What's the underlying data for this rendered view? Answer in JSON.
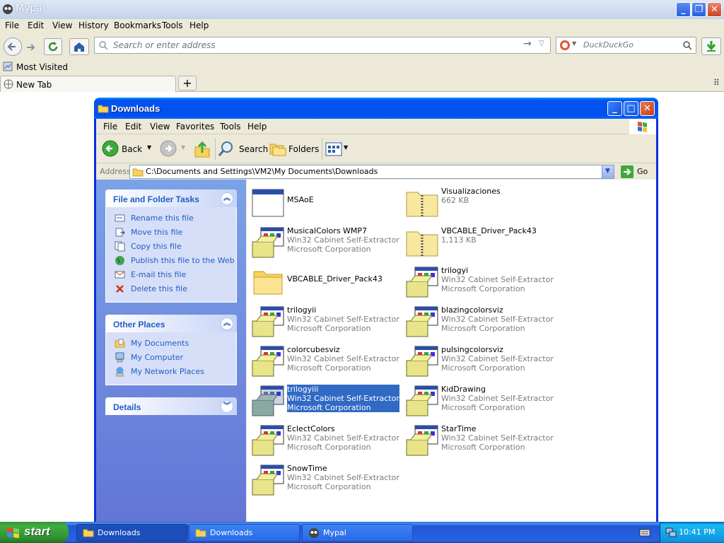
{
  "browser": {
    "title": "Mypal",
    "menu": [
      "File",
      "Edit",
      "View",
      "History",
      "Bookmarks",
      "Tools",
      "Help"
    ],
    "url_placeholder": "Search or enter address",
    "search_placeholder": "DuckDuckGo",
    "bookmark": "Most Visited",
    "tab": "New Tab"
  },
  "explorer": {
    "title": "Downloads",
    "menu": [
      "File",
      "Edit",
      "View",
      "Favorites",
      "Tools",
      "Help"
    ],
    "toolbar": {
      "back": "Back",
      "search": "Search",
      "folders": "Folders"
    },
    "address_label": "Address",
    "address": "C:\\Documents and Settings\\VM2\\My Documents\\Downloads",
    "go": "Go",
    "tasks": {
      "file_folder": {
        "title": "File and Folder Tasks",
        "items": [
          "Rename this file",
          "Move this file",
          "Copy this file",
          "Publish this file to the Web",
          "E-mail this file",
          "Delete this file"
        ]
      },
      "other": {
        "title": "Other Places",
        "items": [
          "My Documents",
          "My Computer",
          "My Network Places"
        ]
      },
      "details": {
        "title": "Details"
      }
    },
    "files": [
      {
        "name": "MSAoE",
        "l2": "",
        "l3": "",
        "icon": "window-app-icon"
      },
      {
        "name": "Visualizaciones",
        "l2": "662 KB",
        "l3": "",
        "icon": "zip-folder-icon"
      },
      {
        "name": "MusicalColors WMP7",
        "l2": "Win32 Cabinet Self-Extractor",
        "l3": "Microsoft Corporation",
        "icon": "installer-icon"
      },
      {
        "name": "VBCABLE_Driver_Pack43",
        "l2": "1,113 KB",
        "l3": "",
        "icon": "zip-folder-icon"
      },
      {
        "name": "VBCABLE_Driver_Pack43",
        "l2": "",
        "l3": "",
        "icon": "folder-icon"
      },
      {
        "name": "trilogyi",
        "l2": "Win32 Cabinet Self-Extractor",
        "l3": "Microsoft Corporation",
        "icon": "installer-icon"
      },
      {
        "name": "trilogyii",
        "l2": "Win32 Cabinet Self-Extractor",
        "l3": "Microsoft Corporation",
        "icon": "installer-icon"
      },
      {
        "name": "blazingcolorsviz",
        "l2": "Win32 Cabinet Self-Extractor",
        "l3": "Microsoft Corporation",
        "icon": "installer-icon"
      },
      {
        "name": "colorcubesviz",
        "l2": "Win32 Cabinet Self-Extractor",
        "l3": "Microsoft Corporation",
        "icon": "installer-icon"
      },
      {
        "name": "pulsingcolorsviz",
        "l2": "Win32 Cabinet Self-Extractor",
        "l3": "Microsoft Corporation",
        "icon": "installer-icon"
      },
      {
        "name": "trilogyiii",
        "l2": "Win32 Cabinet Self-Extractor",
        "l3": "Microsoft Corporation",
        "icon": "installer-icon",
        "selected": true
      },
      {
        "name": "KidDrawing",
        "l2": "Win32 Cabinet Self-Extractor",
        "l3": "Microsoft Corporation",
        "icon": "installer-icon"
      },
      {
        "name": "EclectColors",
        "l2": "Win32 Cabinet Self-Extractor",
        "l3": "Microsoft Corporation",
        "icon": "installer-icon"
      },
      {
        "name": "StarTime",
        "l2": "Win32 Cabinet Self-Extractor",
        "l3": "Microsoft Corporation",
        "icon": "installer-icon"
      },
      {
        "name": "SnowTime",
        "l2": "Win32 Cabinet Self-Extractor",
        "l3": "Microsoft Corporation",
        "icon": "installer-icon"
      }
    ]
  },
  "taskbar": {
    "start": "start",
    "buttons": [
      "Downloads",
      "Downloads",
      "Mypal"
    ],
    "clock": "10:41 PM"
  },
  "colors": {
    "xp_blue": "#0053ee",
    "task_link": "#215dc6",
    "selection": "#316ac5"
  }
}
